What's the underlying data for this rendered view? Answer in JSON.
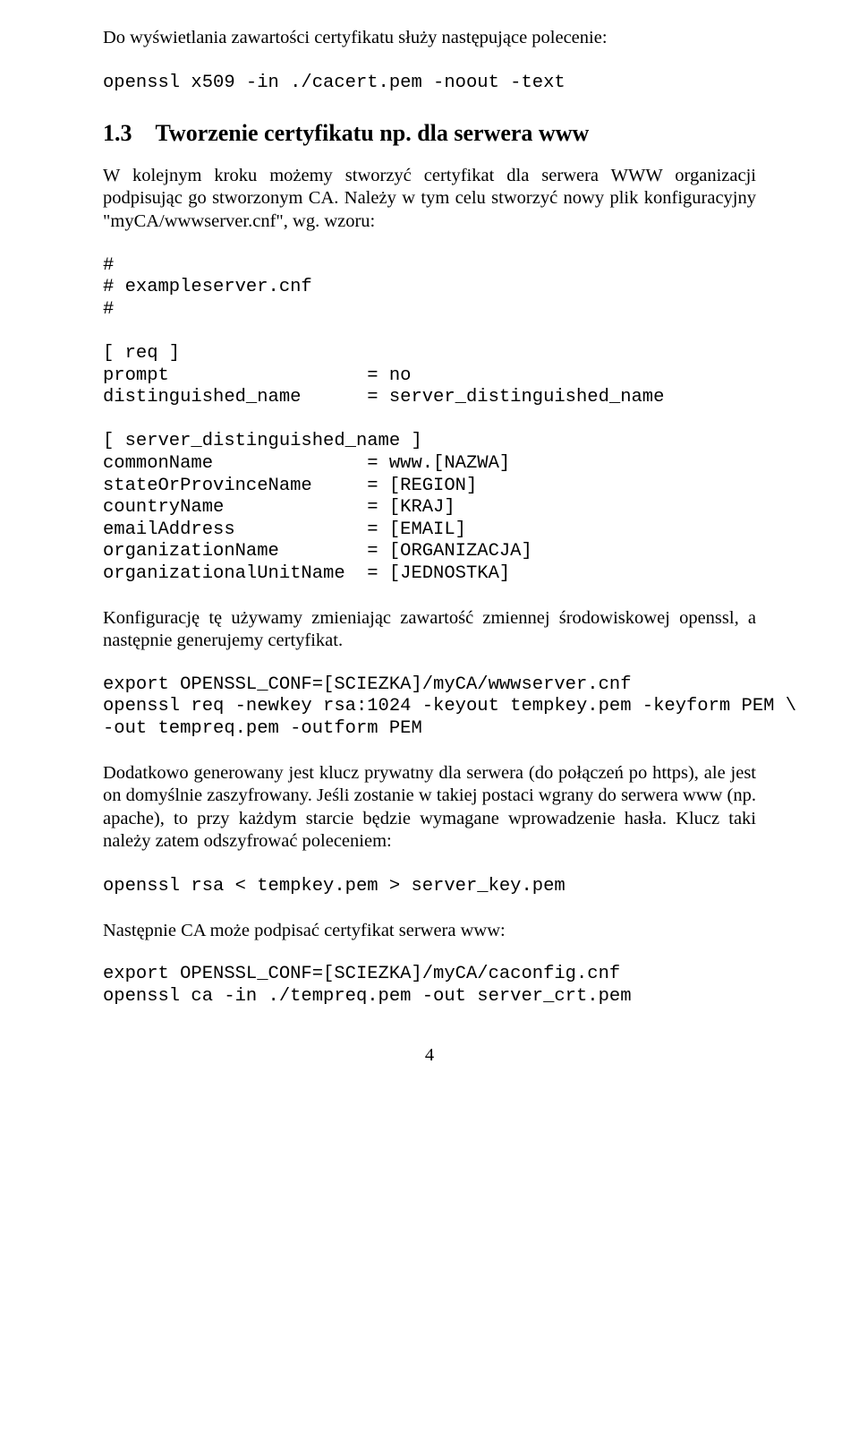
{
  "p1": "Do wyświetlania zawartości certyfikatu służy następujące polecenie:",
  "cmd1": "openssl x509 -in ./cacert.pem -noout -text",
  "section_num": "1.3",
  "section_title": "Tworzenie certyfikatu np. dla serwera www",
  "p2": "W kolejnym kroku możemy stworzyć certyfikat dla serwera WWW organizacji podpisując go stworzonym CA. Należy w tym celu stworzyć nowy plik konfiguracyjny \"myCA/wwwserver.cnf\", wg. wzoru:",
  "cnf": "#\n# exampleserver.cnf\n#\n\n[ req ]\nprompt                  = no\ndistinguished_name      = server_distinguished_name\n\n[ server_distinguished_name ]\ncommonName              = www.[NAZWA]\nstateOrProvinceName     = [REGION]\ncountryName             = [KRAJ]\nemailAddress            = [EMAIL]\norganizationName        = [ORGANIZACJA]\norganizationalUnitName  = [JEDNOSTKA]",
  "p3": "Konfigurację tę używamy zmieniając zawartość zmiennej środowiskowej openssl, a następnie generujemy certyfikat.",
  "cmd2": "export OPENSSL_CONF=[SCIEZKA]/myCA/wwwserver.cnf\nopenssl req -newkey rsa:1024 -keyout tempkey.pem -keyform PEM \\\n-out tempreq.pem -outform PEM",
  "p4": "Dodatkowo generowany jest klucz prywatny dla serwera (do połączeń po https), ale jest on domyślnie zaszyfrowany. Jeśli zostanie w takiej postaci wgrany do serwera www (np. apache), to przy każdym starcie będzie wymagane wprowadzenie hasła. Klucz taki należy zatem odszyfrować poleceniem:",
  "cmd3": "openssl rsa < tempkey.pem > server_key.pem",
  "p5": "Następnie CA może podpisać certyfikat serwera www:",
  "cmd4": "export OPENSSL_CONF=[SCIEZKA]/myCA/caconfig.cnf\nopenssl ca -in ./tempreq.pem -out server_crt.pem",
  "page_number": "4"
}
